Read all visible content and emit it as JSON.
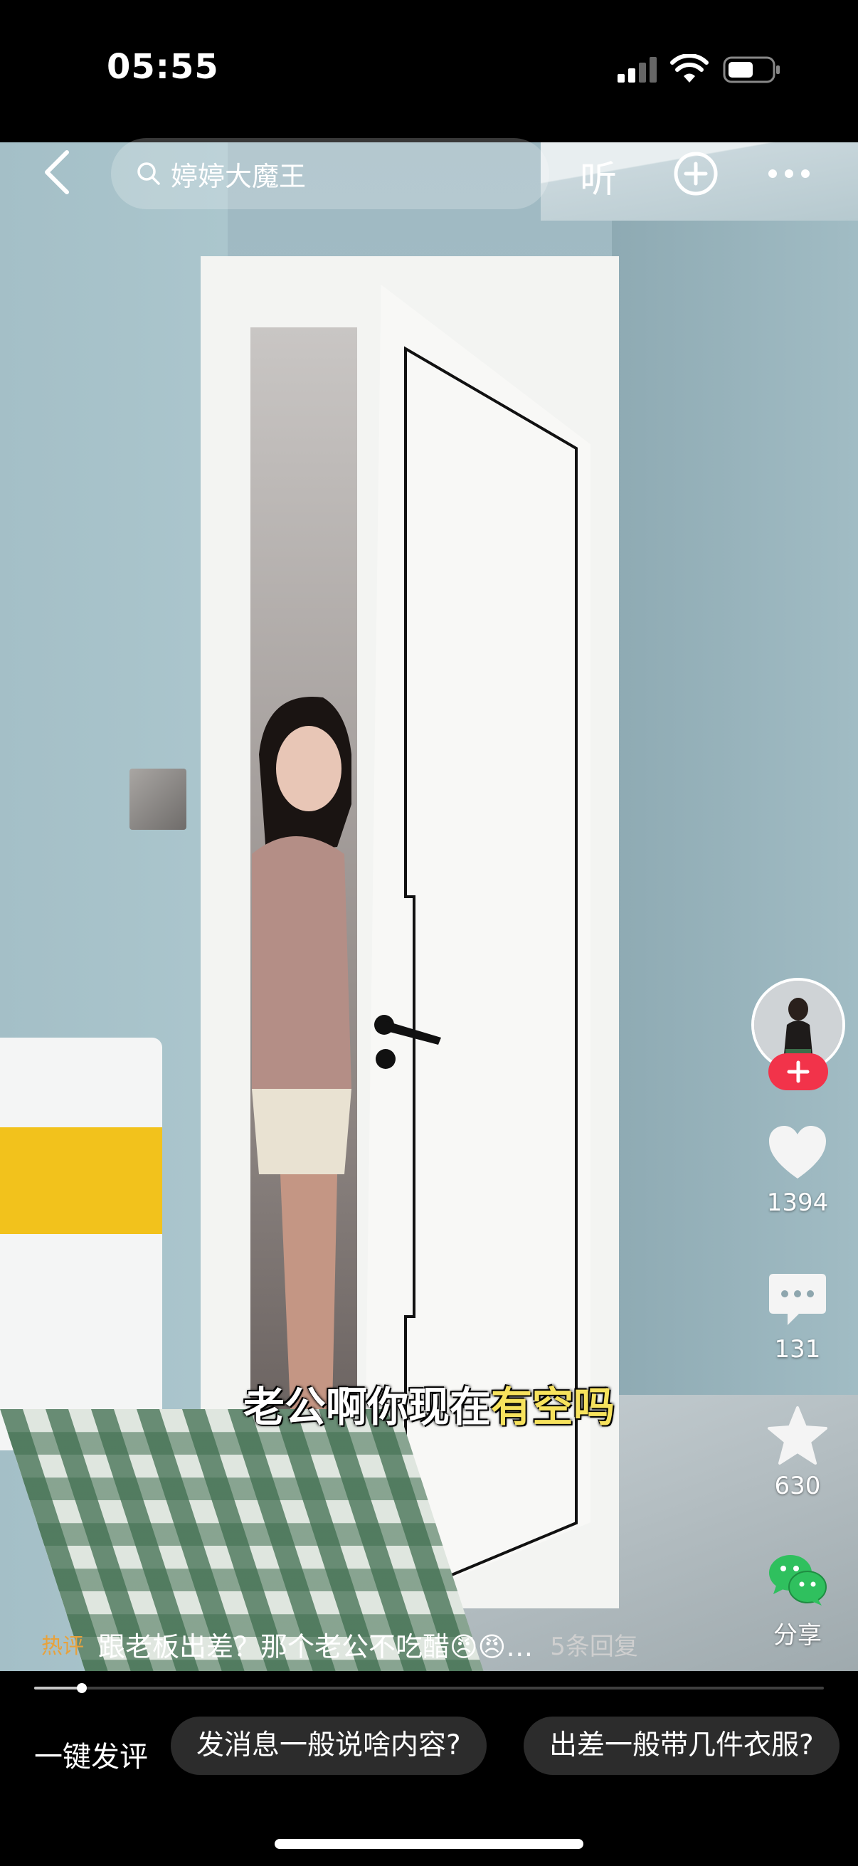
{
  "status_bar": {
    "time": "05:55"
  },
  "top_bar": {
    "search_text": "婷婷大魔王",
    "listen_label": "听"
  },
  "caption": {
    "plain": "老公啊你现在",
    "highlight": "有空吗"
  },
  "rail": {
    "likes": "1394",
    "comments": "131",
    "favorites": "630",
    "share_label": "分享"
  },
  "comment_preview": {
    "tag": "热评",
    "text": "跟老板出差？那个老公不吃醋😠😠…",
    "replies": "5条回复"
  },
  "progress": {
    "value": 0.06
  },
  "quick_comments": {
    "label": "一键发评",
    "chips": [
      "发消息一般说啥内容?",
      "出差一般带几件衣服?"
    ]
  },
  "colors": {
    "follow": "#f2334a",
    "hot_tag": "#e8a23c",
    "caption_highlight": "#f7e25d",
    "share_green": "#2fc05e"
  }
}
